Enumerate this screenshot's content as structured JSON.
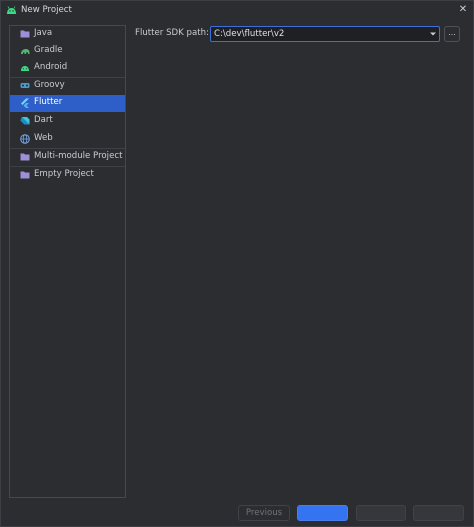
{
  "window": {
    "title": "New Project"
  },
  "sidebar": {
    "items": [
      {
        "label": "Java",
        "icon": "folder-icon"
      },
      {
        "label": "Gradle",
        "icon": "gradle-icon"
      },
      {
        "label": "Android",
        "icon": "android-icon"
      },
      {
        "label": "Groovy",
        "icon": "groovy-icon"
      },
      {
        "label": "Flutter",
        "icon": "flutter-icon",
        "selected": true
      },
      {
        "label": "Dart",
        "icon": "dart-icon"
      },
      {
        "label": "Web",
        "icon": "globe-icon"
      },
      {
        "label": "Multi-module Project",
        "icon": "folder-icon"
      },
      {
        "label": "Empty Project",
        "icon": "folder-icon"
      }
    ]
  },
  "form": {
    "sdk_path_label": "Flutter SDK path:",
    "sdk_path_value": "C:\\dev\\flutter\\v2",
    "browse_label": "..."
  },
  "footer": {
    "previous_label": "Previous",
    "next_label": "",
    "create_label": "",
    "cancel_label": ""
  },
  "colors": {
    "accent": "#3574f0",
    "selection": "#2e5fc9",
    "background": "#2b2d30"
  }
}
